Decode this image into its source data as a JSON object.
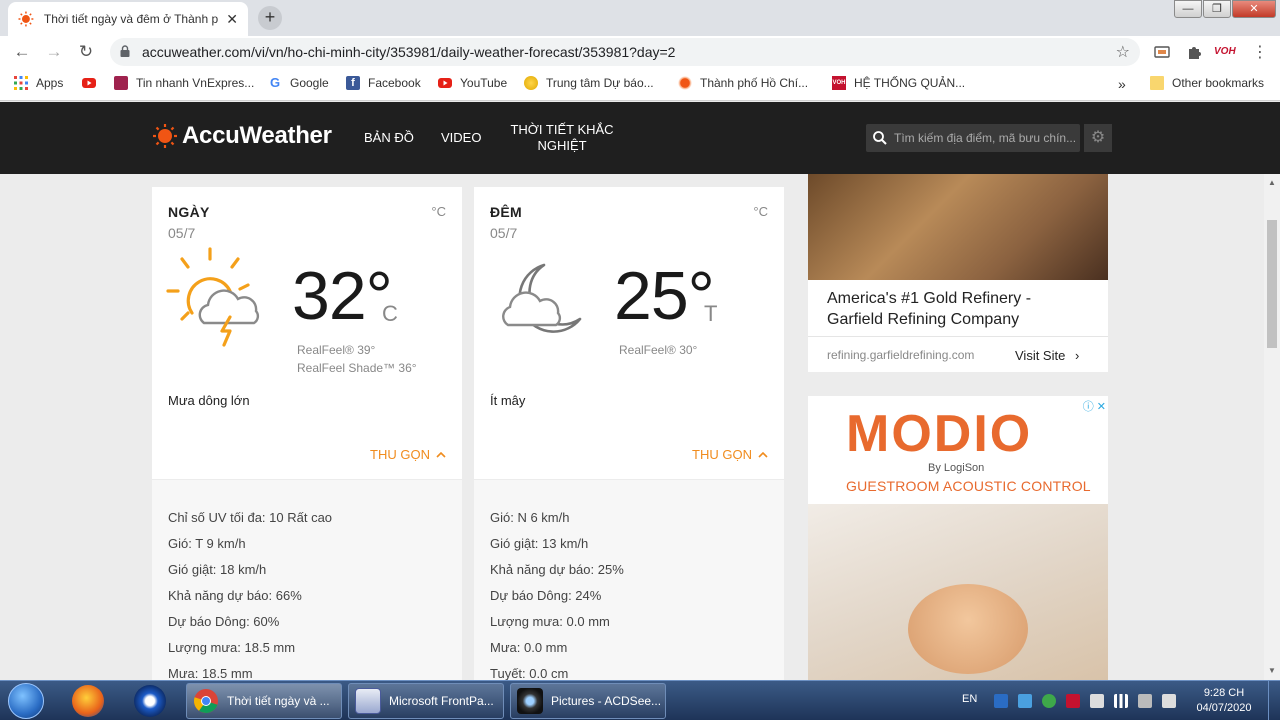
{
  "browser": {
    "tab_title": "Thời tiết ngày và đêm ở Thành p",
    "url": "accuweather.com/vi/vn/ho-chi-minh-city/353981/daily-weather-forecast/353981?day=2",
    "bookmarks": [
      "Apps",
      "Tin nhanh VnExpres...",
      "Google",
      "Facebook",
      "YouTube",
      "Trung tâm Dự báo...",
      "Thành phố Hồ Chí...",
      "HỆ THỐNG QUẢN...",
      "Other bookmarks"
    ],
    "overflow": "»"
  },
  "accuweather": {
    "brand": "AccuWeather",
    "nav": [
      "BẢN ĐỒ",
      "VIDEO",
      "THỜI TIẾT KHẮC",
      "NGHIỆT"
    ],
    "search_placeholder": "Tìm kiếm địa điểm, mã bưu chín..."
  },
  "day_card": {
    "label": "NGÀY",
    "date": "05/7",
    "unit": "°C",
    "temp": "32°",
    "temp_letter": "C",
    "realfeel": "RealFeel® 39°",
    "realfeel_shade": "RealFeel Shade™ 36°",
    "phrase": "Mưa dông lớn",
    "collapse": "THU GỌN",
    "details": [
      "Chỉ số UV tối đa: 10 Rất cao",
      "Gió: T 9 km/h",
      "Gió giật: 18 km/h",
      "Khả năng dự báo: 66%",
      "Dự báo Dông: 60%",
      "Lượng mưa: 18.5 mm",
      "Mưa: 18.5 mm"
    ]
  },
  "night_card": {
    "label": "ĐÊM",
    "date": "05/7",
    "unit": "°C",
    "temp": "25°",
    "temp_letter": "T",
    "realfeel": "RealFeel® 30°",
    "phrase": "Ít mây",
    "collapse": "THU GỌN",
    "details": [
      "Gió: N 6 km/h",
      "Gió giật: 13 km/h",
      "Khả năng dự báo: 25%",
      "Dự báo Dông: 24%",
      "Lượng mưa: 0.0 mm",
      "Mưa: 0.0 mm",
      "Tuyết: 0.0 cm"
    ]
  },
  "ads": {
    "ad1_title": "America's #1 Gold Refinery - Garfield Refining Company",
    "ad1_domain": "refining.garfieldrefining.com",
    "ad1_visit": "Visit Site",
    "ad2_brand": "MODIO",
    "ad2_by": "By LogiSon",
    "ad2_tag": "GUESTROOM ACOUSTIC CONTROL"
  },
  "taskbar": {
    "tasks": [
      "Thời tiết ngày và ...",
      "Microsoft FrontPa...",
      "Pictures - ACDSee..."
    ],
    "lang": "EN",
    "time": "9:28 CH",
    "date": "04/07/2020"
  },
  "colors": {
    "accent_orange": "#f08c1e",
    "header_dark": "#1f1f1f",
    "ad_orange": "#e86a2e"
  }
}
